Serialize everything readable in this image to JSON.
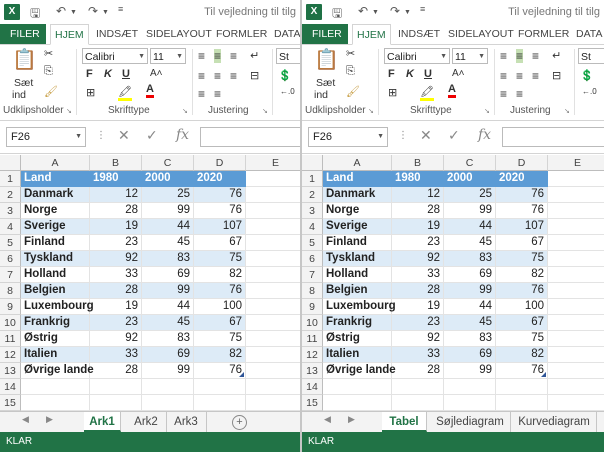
{
  "app": {
    "logo": "X",
    "title": "Til vejledning til tilg",
    "tabs": [
      "FILER",
      "HJEM",
      "INDSÆT",
      "SIDELAYOUT",
      "FORMLER",
      "DATA"
    ],
    "ribbon": {
      "paste_label": "Sæt",
      "paste_label2": "ind",
      "font_name": "Calibri",
      "font_size": "11",
      "bold": "F",
      "italic": "K",
      "underline": "U",
      "style_label": "St",
      "groups": [
        "Udklipsholder",
        "Skrifttype",
        "Justering"
      ]
    },
    "name_box": "F26",
    "fx_label": "fx",
    "status": "KLAR",
    "accent_color": "#217346",
    "header_color": "#5b9bd5",
    "band_color": "#ddebf7"
  },
  "columns": [
    "A",
    "B",
    "C",
    "D",
    "E"
  ],
  "rows": [
    "1",
    "2",
    "3",
    "4",
    "5",
    "6",
    "7",
    "8",
    "9",
    "10",
    "11",
    "12",
    "13",
    "14",
    "15"
  ],
  "table": {
    "headers": [
      "Land",
      "1980",
      "2000",
      "2020"
    ],
    "data": [
      [
        "Danmark",
        "12",
        "25",
        "76"
      ],
      [
        "Norge",
        "28",
        "99",
        "76"
      ],
      [
        "Sverige",
        "19",
        "44",
        "107"
      ],
      [
        "Finland",
        "23",
        "45",
        "67"
      ],
      [
        "Tyskland",
        "92",
        "83",
        "75"
      ],
      [
        "Holland",
        "33",
        "69",
        "82"
      ],
      [
        "Belgien",
        "28",
        "99",
        "76"
      ],
      [
        "Luxembourg",
        "19",
        "44",
        "100"
      ],
      [
        "Frankrig",
        "23",
        "45",
        "67"
      ],
      [
        "Østrig",
        "92",
        "83",
        "75"
      ],
      [
        "Italien",
        "33",
        "69",
        "82"
      ],
      [
        "Øvrige lande",
        "28",
        "99",
        "76"
      ]
    ]
  },
  "left_sheets": [
    "Ark1",
    "Ark2",
    "Ark3"
  ],
  "right_sheets": [
    "Tabel",
    "Søjlediagram",
    "Kurvediagram"
  ],
  "add_sheet": "+"
}
